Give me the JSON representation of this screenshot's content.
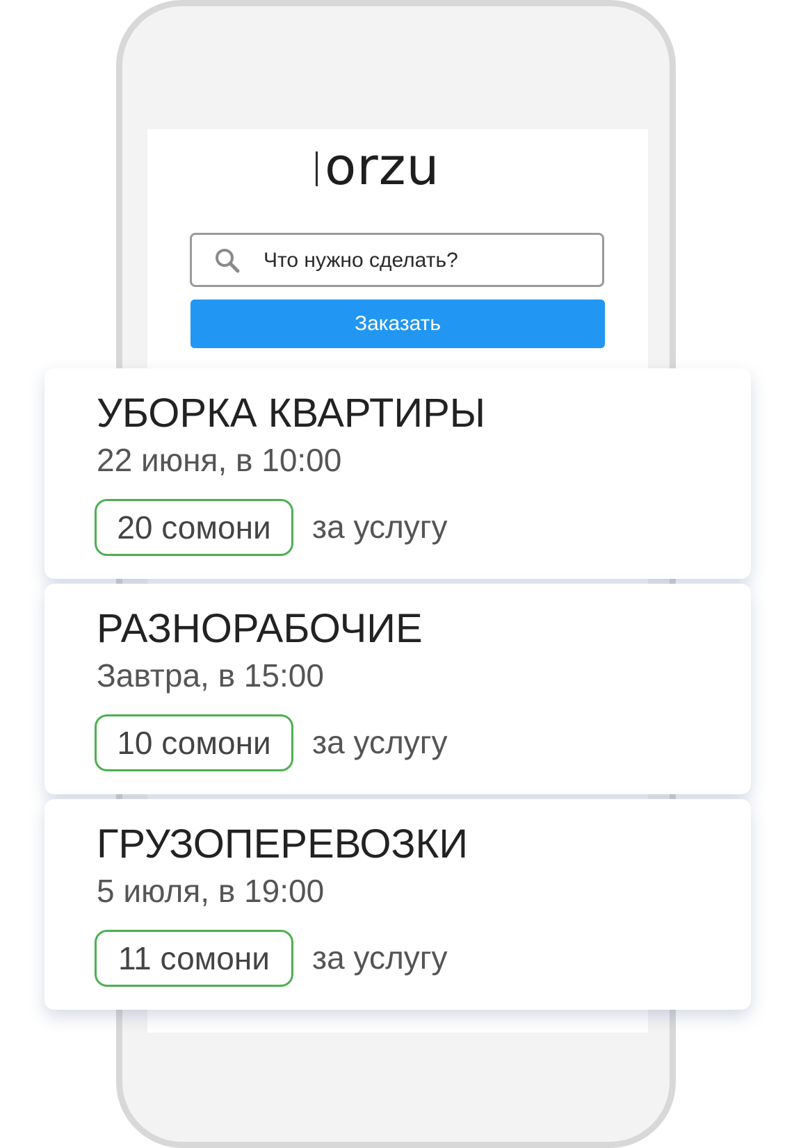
{
  "app": {
    "logo_text": "orzu"
  },
  "search": {
    "placeholder": "Что нужно сделать?",
    "icon": "search-icon"
  },
  "order_button": {
    "label": "Заказать",
    "color": "#2196f3"
  },
  "price_suffix": "за услугу",
  "colors": {
    "badge_border": "#4caf50"
  },
  "cards": [
    {
      "title": "УБОРКА КВАРТИРЫ",
      "datetime": "22 июня, в 10:00",
      "price": "20 сомони"
    },
    {
      "title": "РАЗНОРАБОЧИЕ",
      "datetime": "Завтра, в 15:00",
      "price": "10 сомони"
    },
    {
      "title": "ГРУЗОПЕРЕВОЗКИ",
      "datetime": "5 июля, в 19:00",
      "price": "11 сомони"
    }
  ]
}
